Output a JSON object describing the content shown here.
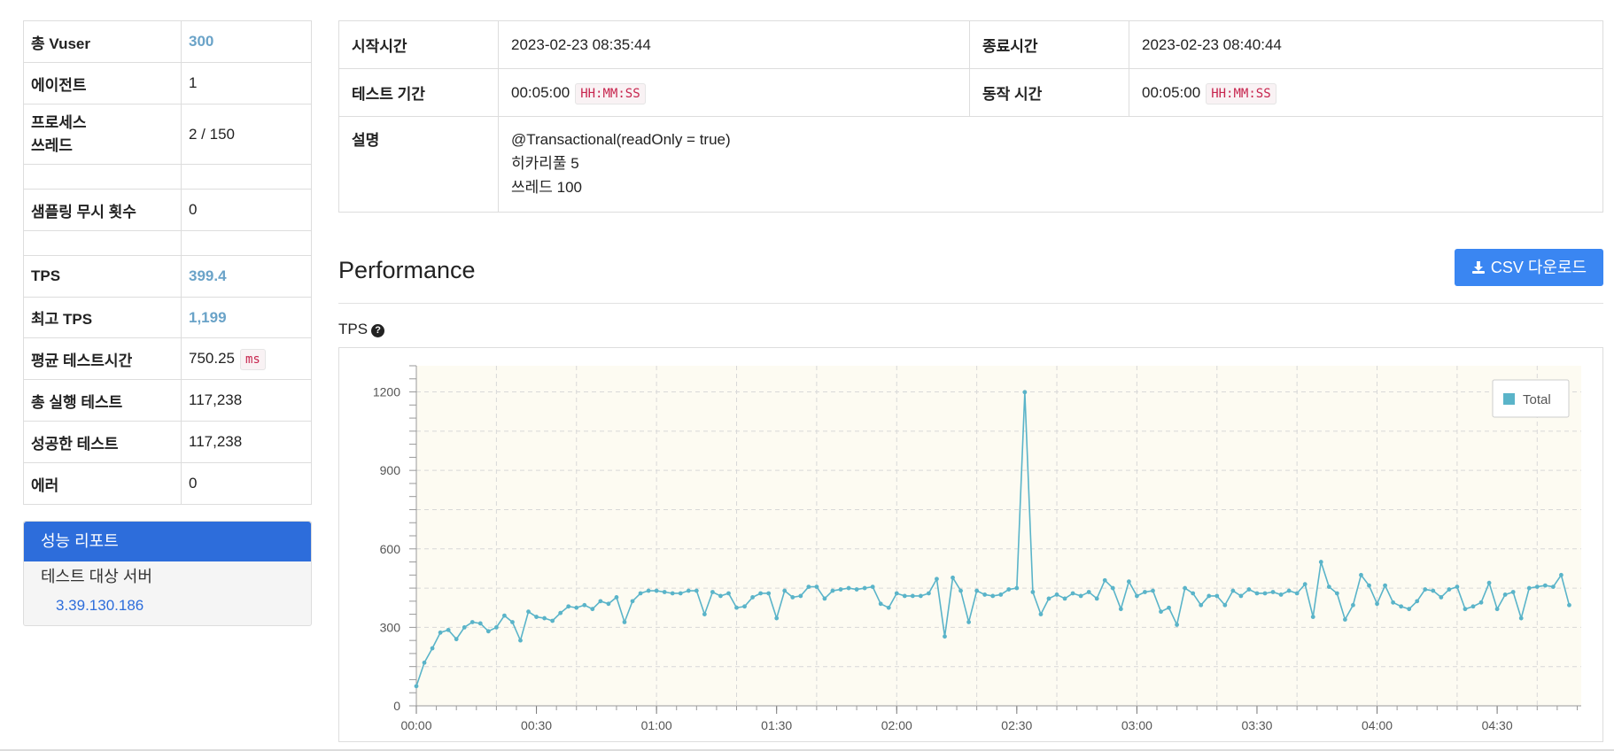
{
  "summary": {
    "rows": [
      {
        "label": "총 Vuser",
        "value": "300",
        "accent": true
      },
      {
        "label": "에이전트",
        "value": "1"
      },
      {
        "label_lines": [
          "프로세스",
          "쓰레드"
        ],
        "value": "2 / 150"
      },
      {
        "spacer": true
      },
      {
        "label": "샘플링 무시 횟수",
        "value": "0"
      },
      {
        "spacer": true
      },
      {
        "label": "TPS",
        "value": "399.4",
        "accent": true
      },
      {
        "label": "최고 TPS",
        "value": "1,199",
        "accent": true
      },
      {
        "label": "평균 테스트시간",
        "value": "750.25",
        "unit": "ms"
      },
      {
        "label": "총 실행 테스트",
        "value": "117,238"
      },
      {
        "label": "성공한 테스트",
        "value": "117,238"
      },
      {
        "label": "에러",
        "value": "0"
      }
    ]
  },
  "report_panel": {
    "title": "성능 리포트",
    "subtitle": "테스트 대상 서버",
    "server": "3.39.130.186"
  },
  "info": {
    "start_label": "시작시간",
    "start_value": "2023-02-23 08:35:44",
    "end_label": "종료시간",
    "end_value": "2023-02-23 08:40:44",
    "duration_label": "테스트 기간",
    "duration_value": "00:05:00",
    "duration_format": "HH:MM:SS",
    "runtime_label": "동작 시간",
    "runtime_value": "00:05:00",
    "runtime_format": "HH:MM:SS",
    "desc_label": "설명",
    "desc_lines": [
      "@Transactional(readOnly = true)",
      "히카리풀 5",
      "쓰레드 100"
    ]
  },
  "performance": {
    "title": "Performance",
    "csv_button": "CSV 다운로드",
    "tps_label": "TPS"
  },
  "colors": {
    "accent": "#3a86f2",
    "series": "#5ab4c9",
    "plot_bg": "#fdfbf2",
    "report_head": "#2d6ddb"
  },
  "chart_data": {
    "type": "line",
    "ylim": [
      0,
      1300
    ],
    "y_ticks": [
      0,
      300,
      600,
      900,
      1200
    ],
    "x_ticks": [
      "00:00",
      "00:30",
      "01:00",
      "01:30",
      "02:00",
      "02:30",
      "03:00",
      "03:30",
      "04:00",
      "04:30"
    ],
    "x_step_seconds": 2,
    "x_max_seconds": 291,
    "legend": "top-right",
    "grid": true,
    "series": [
      {
        "name": "Total",
        "values": [
          75,
          165,
          220,
          280,
          290,
          255,
          300,
          320,
          315,
          285,
          300,
          345,
          320,
          250,
          360,
          340,
          335,
          325,
          355,
          380,
          375,
          385,
          370,
          400,
          390,
          415,
          320,
          400,
          430,
          440,
          440,
          435,
          430,
          430,
          440,
          440,
          350,
          435,
          420,
          430,
          375,
          380,
          415,
          430,
          430,
          335,
          440,
          415,
          420,
          455,
          455,
          410,
          440,
          445,
          450,
          445,
          450,
          455,
          390,
          375,
          430,
          420,
          420,
          420,
          430,
          485,
          265,
          490,
          440,
          320,
          440,
          425,
          420,
          425,
          445,
          450,
          1199,
          435,
          350,
          410,
          425,
          410,
          430,
          420,
          435,
          410,
          480,
          450,
          370,
          475,
          420,
          435,
          440,
          360,
          375,
          310,
          450,
          430,
          385,
          420,
          420,
          385,
          440,
          420,
          445,
          430,
          430,
          435,
          425,
          440,
          430,
          465,
          340,
          550,
          455,
          430,
          330,
          385,
          500,
          460,
          390,
          460,
          395,
          380,
          370,
          400,
          445,
          440,
          415,
          445,
          455,
          370,
          380,
          395,
          470,
          370,
          425,
          435,
          335,
          450,
          455,
          460,
          455,
          500,
          385
        ]
      }
    ]
  }
}
